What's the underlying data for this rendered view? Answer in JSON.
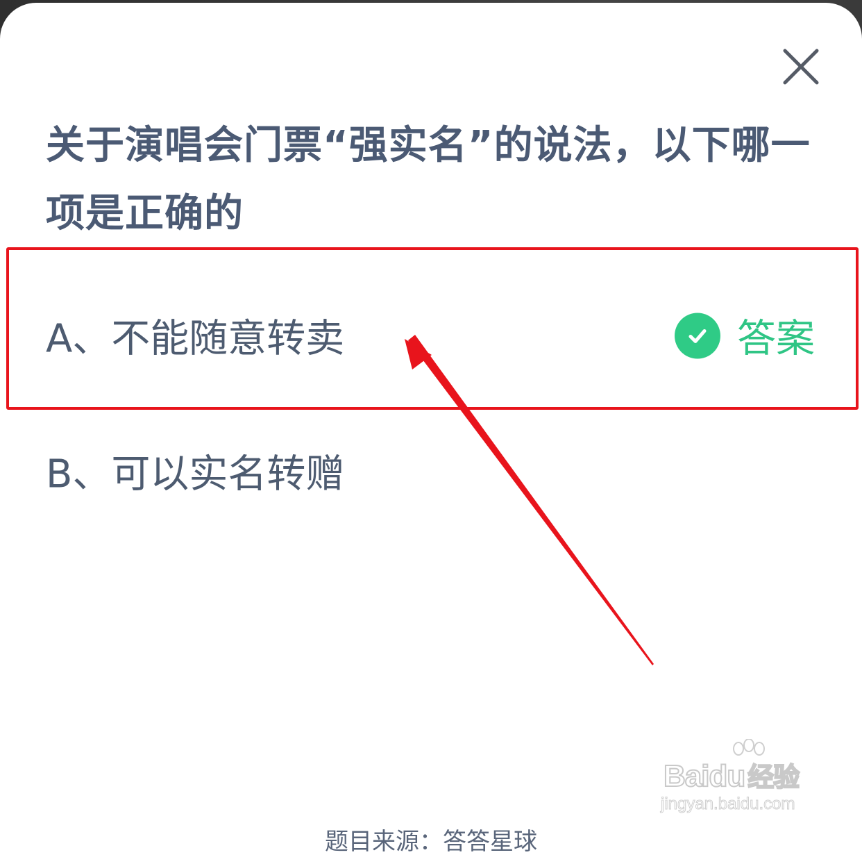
{
  "question": {
    "text": "关于演唱会门票“强实名”的说法，以下哪一项是正确的"
  },
  "options": [
    {
      "label": "A、不能随意转卖",
      "is_answer": true
    },
    {
      "label": "B、可以实名转赠",
      "is_answer": false
    }
  ],
  "answer_tag": {
    "label": "答案",
    "color": "#2fc585"
  },
  "footer": {
    "source_text": "题目来源：答答星球"
  },
  "watermark": {
    "logo": "Bai",
    "logo_mid": "du",
    "logo_cn": "经验",
    "url": "jingyan.baidu.com"
  },
  "colors": {
    "question_text": "#4b5a74",
    "option_text": "#4d5b70",
    "annotation_red": "#e8141c",
    "check_green": "#2fcb86"
  }
}
